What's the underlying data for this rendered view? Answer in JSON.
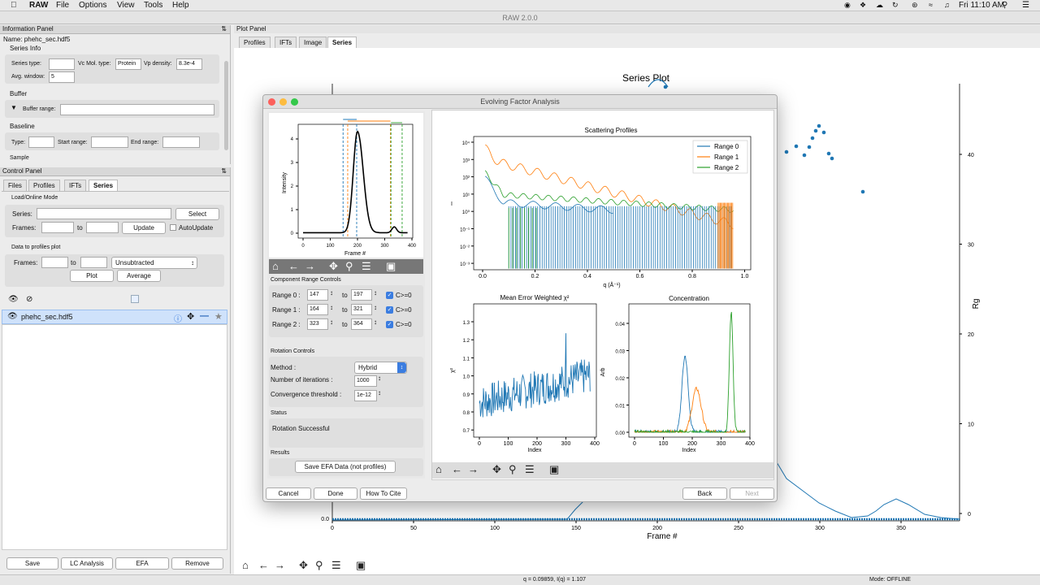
{
  "menubar": {
    "app": "RAW",
    "items": [
      "File",
      "Options",
      "View",
      "Tools",
      "Help"
    ],
    "clock": "Fri 11:10 AM"
  },
  "window": {
    "title": "RAW 2.0.0"
  },
  "info_panel": {
    "title": "Information Panel",
    "name_label": "Name:",
    "name_value": "phehc_sec.hdf5",
    "series_info": "Series Info",
    "series_type_label": "Series type:",
    "series_type_value": "",
    "vc_label": "Vc Mol. type:",
    "vc_value": "Protein",
    "vp_label": "Vp density:",
    "vp_value": "8.3e-4",
    "avg_label": "Avg. window:",
    "avg_value": "5",
    "buffer": "Buffer",
    "buffer_range": "Buffer range:",
    "baseline": "Baseline",
    "type_label": "Type:",
    "start_label": "Start range:",
    "end_label": "End range:",
    "sample": "Sample"
  },
  "control_panel": {
    "title": "Control Panel",
    "tabs": [
      "Files",
      "Profiles",
      "IFTs",
      "Series"
    ],
    "load_mode": "Load/Online Mode",
    "series_label": "Series:",
    "select": "Select",
    "frames_label": "Frames:",
    "to": "to",
    "update": "Update",
    "autoupdate": "AutoUpdate",
    "data_to_profiles": "Data to profiles plot",
    "dropdown": "Unsubtracted",
    "plot": "Plot",
    "average": "Average",
    "item": "phehc_sec.hdf5",
    "buttons": [
      "Save",
      "LC Analysis",
      "EFA",
      "Remove"
    ]
  },
  "plot_panel": {
    "title": "Plot Panel",
    "tabs": [
      "Profiles",
      "IFTs",
      "Image",
      "Series"
    ],
    "plot_title": "Series Plot",
    "xlabel": "Frame #",
    "ylabel_right": "Rg",
    "xticks": [
      "0",
      "50",
      "100",
      "150",
      "200",
      "250",
      "300",
      "350"
    ],
    "yticks_right": [
      "0",
      "10",
      "20",
      "30",
      "40"
    ],
    "ytick_left": "0.0"
  },
  "status_bar": {
    "coords": "q = 0.09859, I(q) = 1.107",
    "mode": "Mode: OFFLINE"
  },
  "efa": {
    "title": "Evolving Factor Analysis",
    "component_range": "Component Range Controls",
    "ranges": [
      {
        "label": "Range 0 :",
        "start": "147",
        "end": "197",
        "chk": "C>=0"
      },
      {
        "label": "Range 1 :",
        "start": "164",
        "end": "321",
        "chk": "C>=0"
      },
      {
        "label": "Range 2 :",
        "start": "323",
        "end": "364",
        "chk": "C>=0"
      }
    ],
    "to": "to",
    "rotation": "Rotation Controls",
    "method_label": "Method :",
    "method_value": "Hybrid",
    "iter_label": "Number of iterations :",
    "iter_value": "1000",
    "conv_label": "Convergence threshold :",
    "conv_value": "1e-12",
    "status_hdr": "Status",
    "status_text": "Rotation Successful",
    "results_hdr": "Results",
    "save_btn": "Save EFA Data (not profiles)",
    "buttons": {
      "cancel": "Cancel",
      "done": "Done",
      "cite": "How To Cite",
      "back": "Back",
      "next": "Next"
    },
    "mini_plot": {
      "xlabel": "Frame #",
      "ylabel": "Intensity",
      "xticks": [
        "0",
        "100",
        "200",
        "300",
        "400"
      ],
      "yticks": [
        "0",
        "1",
        "2",
        "3",
        "4"
      ]
    },
    "sp": {
      "title": "Scattering Profiles",
      "xlabel": "q (Å⁻¹)",
      "ylabel": "I",
      "legend": [
        "Range 0",
        "Range 1",
        "Range 2"
      ],
      "xticks": [
        "0.0",
        "0.2",
        "0.4",
        "0.6",
        "0.8",
        "1.0"
      ],
      "yticks": [
        "10⁴",
        "10³",
        "10²",
        "10¹",
        "10⁰",
        "10⁻¹",
        "10⁻²",
        "10⁻³"
      ]
    },
    "chi": {
      "title": "Mean Error Weighted χ²",
      "xlabel": "Index",
      "ylabel": "χ²",
      "xticks": [
        "0",
        "100",
        "200",
        "300",
        "400"
      ],
      "yticks": [
        "1.3",
        "1.2",
        "1.1",
        "1.0",
        "0.9",
        "0.8",
        "0.7"
      ]
    },
    "conc": {
      "title": "Concentration",
      "xlabel": "Index",
      "ylabel": "Arb",
      "xticks": [
        "0",
        "100",
        "200",
        "300",
        "400"
      ],
      "yticks": [
        "0.04",
        "0.03",
        "0.02",
        "0.01",
        "0.00"
      ]
    }
  },
  "colors": {
    "c0": "#1f77b4",
    "c1": "#ff7f0e",
    "c2": "#2ca02c"
  }
}
